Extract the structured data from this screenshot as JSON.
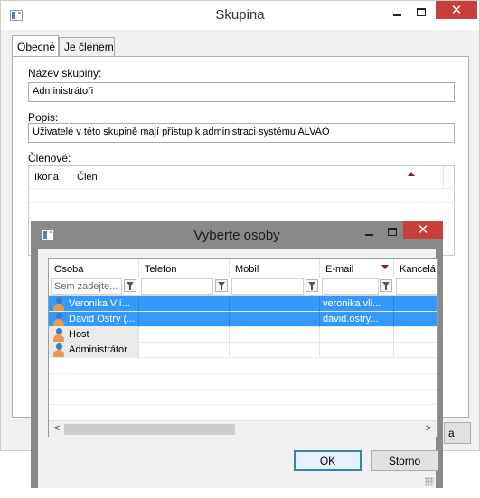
{
  "main_window": {
    "title": "Skupina",
    "caption": {
      "minimize": "–",
      "maximize": "□",
      "close": "✕"
    },
    "tabs": [
      {
        "label": "Obecné",
        "active": true
      },
      {
        "label": "Je členem",
        "active": false
      }
    ],
    "fields": {
      "name_label": "Název skupiny:",
      "name_value": "Administrátoři",
      "desc_label": "Popis:",
      "desc_value": "Uživatelé v této skupině mají přístup k administraci systému ALVAO",
      "members_label": "Členové:"
    },
    "members_grid": {
      "columns": [
        "Ikona",
        "Člen"
      ],
      "sort_column": "Člen",
      "sort_direction": "ascending"
    },
    "partial_button": "a"
  },
  "dialog": {
    "title": "Vyberte osoby",
    "caption": {
      "minimize": "–",
      "maximize": "□",
      "close": "✕"
    },
    "columns": [
      "Osoba",
      "Telefon",
      "Mobil",
      "E-mail",
      "Kancelá"
    ],
    "sort_column": "E-mail",
    "sort_direction": "descending",
    "filter_placeholder": "Sem zadejte...",
    "rows": [
      {
        "person": "Veronika Vlí...",
        "phone": "",
        "mobile": "",
        "email": "veronika.vli...",
        "office": "",
        "selected": true
      },
      {
        "person": "David Ostrý (...",
        "phone": "",
        "mobile": "",
        "email": "david.ostry...",
        "office": "",
        "selected": true
      },
      {
        "person": "Host",
        "phone": "",
        "mobile": "",
        "email": "",
        "office": "",
        "selected": false
      },
      {
        "person": "Administrátor",
        "phone": "",
        "mobile": "",
        "email": "",
        "office": "",
        "selected": false
      }
    ],
    "scroll_left": "<",
    "scroll_right": ">",
    "ok_label": "OK",
    "cancel_label": "Storno"
  },
  "colors": {
    "selection": "#3399ff",
    "close_button": "#c7413a",
    "dialog_frame": "#898989",
    "sort_arrow": "#9a1a32"
  }
}
